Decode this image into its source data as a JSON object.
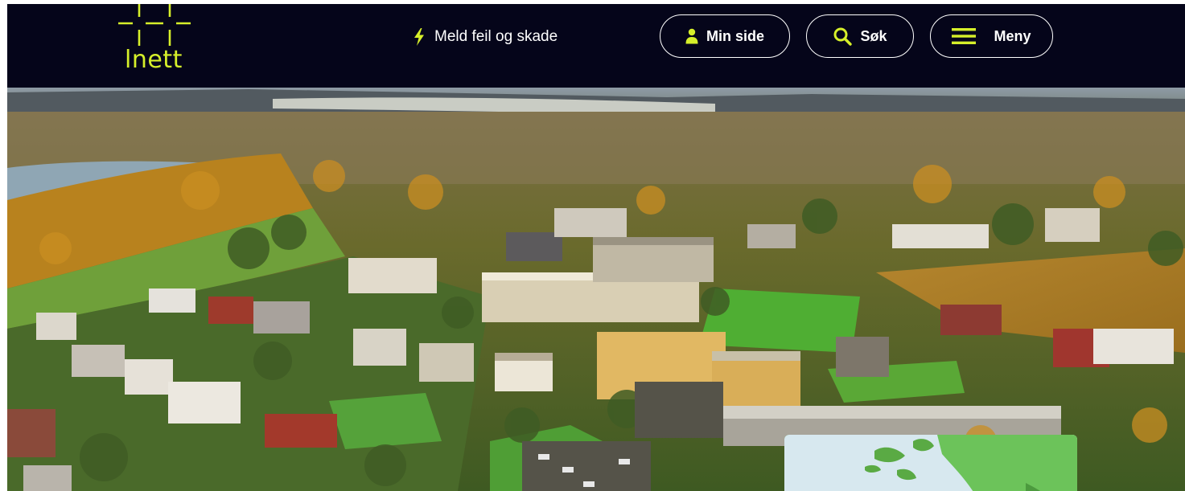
{
  "header": {
    "logo_text": "lnett",
    "report_link": "Meld feil og skade",
    "my_page": "Min side",
    "search": "Søk",
    "menu": "Meny"
  },
  "icons": {
    "logo": "grid-cross-logo-icon",
    "report": "lightning-bolt-icon",
    "my_page": "user-icon",
    "search": "search-icon",
    "menu": "hamburger-menu-icon"
  },
  "colors": {
    "header_bg": "#05051a",
    "accent": "#d6ef2a",
    "card_green": "#6cc35a"
  },
  "hero": {
    "image_subject": "aerial-town-photo"
  }
}
